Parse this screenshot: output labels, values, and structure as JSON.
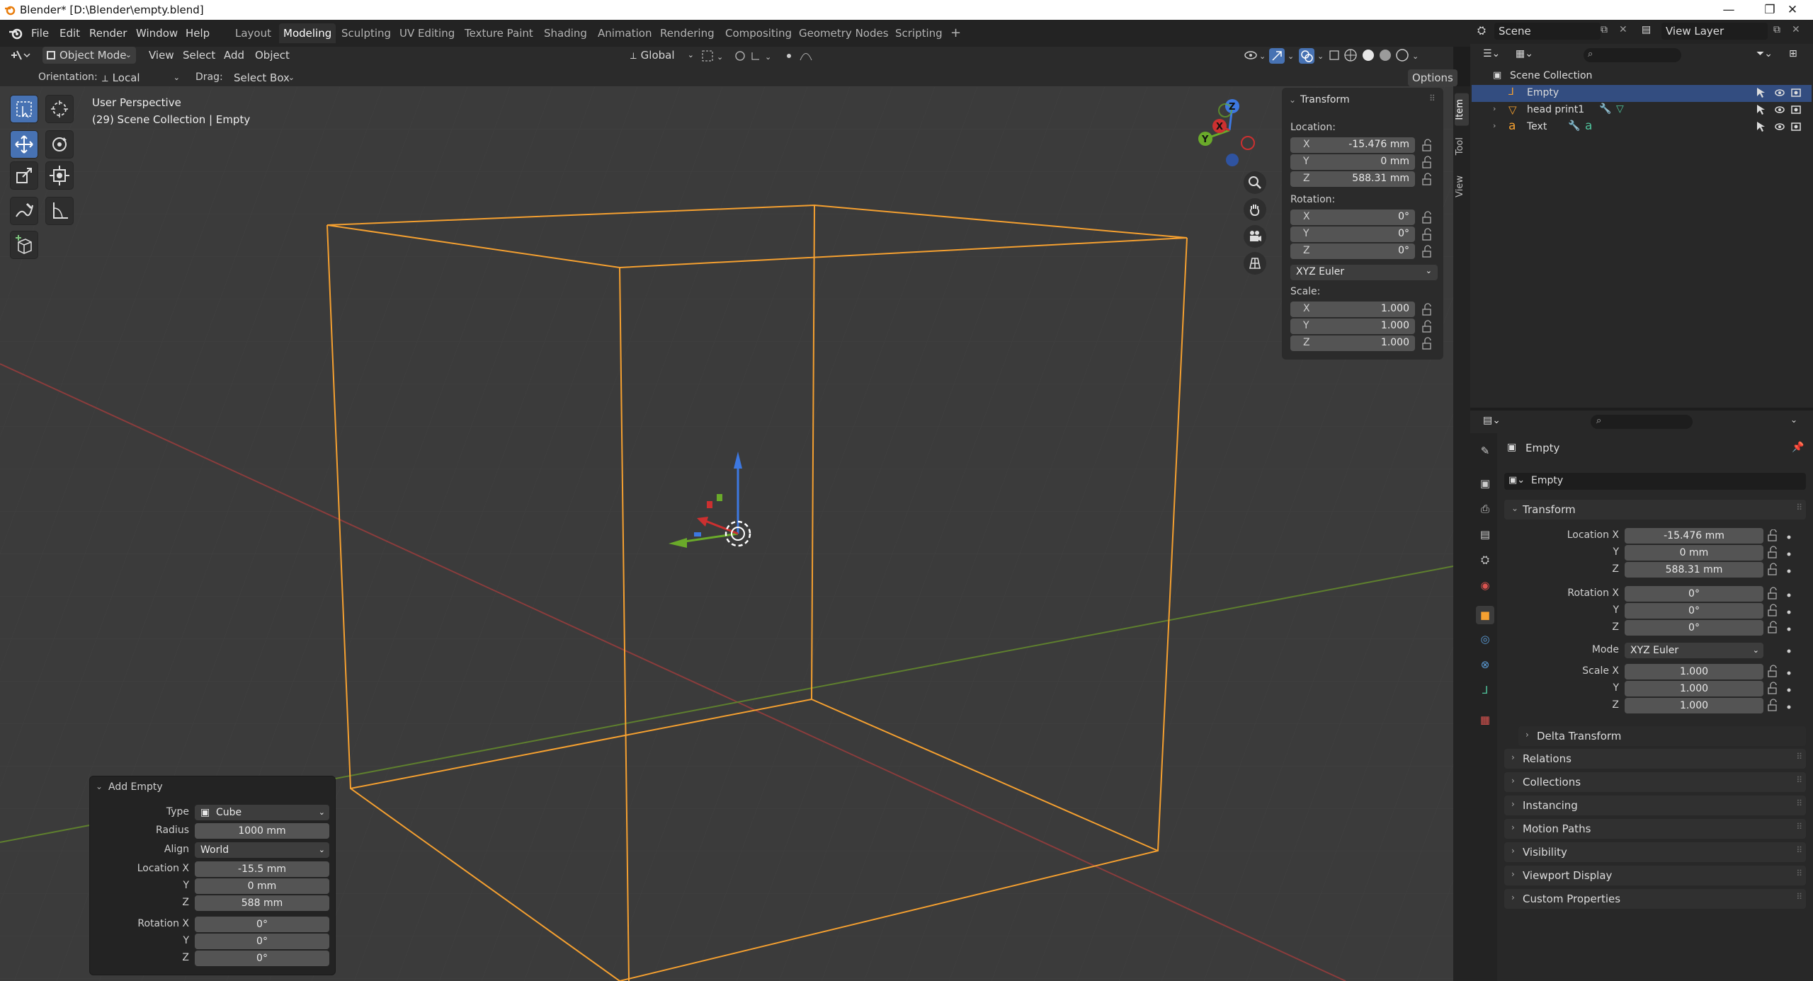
{
  "window": {
    "title": "Blender* [D:\\Blender\\empty.blend]",
    "minimize": "—",
    "maximize": "❐",
    "close": "✕"
  },
  "menu": [
    "File",
    "Edit",
    "Render",
    "Window",
    "Help"
  ],
  "workspaces": [
    "Layout",
    "Modeling",
    "Sculpting",
    "UV Editing",
    "Texture Paint",
    "Shading",
    "Animation",
    "Rendering",
    "Compositing",
    "Geometry Nodes",
    "Scripting"
  ],
  "workspace_add": "+",
  "scene": {
    "label": "Scene",
    "view_layer": "View Layer"
  },
  "viewport_header": {
    "mode": "Object Mode",
    "view": "View",
    "select": "Select",
    "add": "Add",
    "object": "Object",
    "transform_orientation": "Global"
  },
  "tool_settings": {
    "orientation_label": "Orientation:",
    "orientation_value": "Local",
    "drag_label": "Drag:",
    "drag_value": "Select Box",
    "options": "Options"
  },
  "overlay": {
    "perspective": "User Perspective",
    "collection": "(29) Scene Collection | Empty"
  },
  "npanel": {
    "title": "Transform",
    "location_label": "Location:",
    "location": [
      {
        "axis": "X",
        "value": "-15.476 mm"
      },
      {
        "axis": "Y",
        "value": "0 mm"
      },
      {
        "axis": "Z",
        "value": "588.31 mm"
      }
    ],
    "rotation_label": "Rotation:",
    "rotation": [
      {
        "axis": "X",
        "value": "0°"
      },
      {
        "axis": "Y",
        "value": "0°"
      },
      {
        "axis": "Z",
        "value": "0°"
      }
    ],
    "rotation_mode": "XYZ Euler",
    "scale_label": "Scale:",
    "scale": [
      {
        "axis": "X",
        "value": "1.000"
      },
      {
        "axis": "Y",
        "value": "1.000"
      },
      {
        "axis": "Z",
        "value": "1.000"
      }
    ],
    "tabs": [
      "Item",
      "Tool",
      "View"
    ]
  },
  "gizmo": {
    "x": "X",
    "y": "Y",
    "z": "Z"
  },
  "add_empty": {
    "title": "Add Empty",
    "type_label": "Type",
    "type_value": "Cube",
    "radius_label": "Radius",
    "radius_value": "1000 mm",
    "align_label": "Align",
    "align_value": "World",
    "location_label": "Location X",
    "location": [
      "-15.5 mm",
      "0 mm",
      "588 mm"
    ],
    "rotation_label": "Rotation X",
    "rotation": [
      "0°",
      "0°",
      "0°"
    ],
    "y_label": "Y",
    "z_label": "Z"
  },
  "outliner": {
    "root": "Scene Collection",
    "items": [
      "Empty",
      "head print1",
      "Text"
    ]
  },
  "properties": {
    "object_name": "Empty",
    "datablock": "Empty",
    "transform_title": "Transform",
    "location_label": "Location X",
    "location": [
      "-15.476 mm",
      "0 mm",
      "588.31 mm"
    ],
    "rotation_label": "Rotation X",
    "rotation": [
      "0°",
      "0°",
      "0°"
    ],
    "mode_label": "Mode",
    "mode_value": "XYZ Euler",
    "scale_label": "Scale X",
    "scale": [
      "1.000",
      "1.000",
      "1.000"
    ],
    "y_label": "Y",
    "z_label": "Z",
    "delta": "Delta Transform",
    "sections": [
      "Relations",
      "Collections",
      "Instancing",
      "Motion Paths",
      "Visibility",
      "Viewport Display",
      "Custom Properties"
    ]
  },
  "colors": {
    "selection": "#f5a030",
    "x_axis": "#b34545",
    "y_axis": "#6c9a2e",
    "z_axis": "#3d6fd1",
    "active_tool": "#4772b3"
  }
}
